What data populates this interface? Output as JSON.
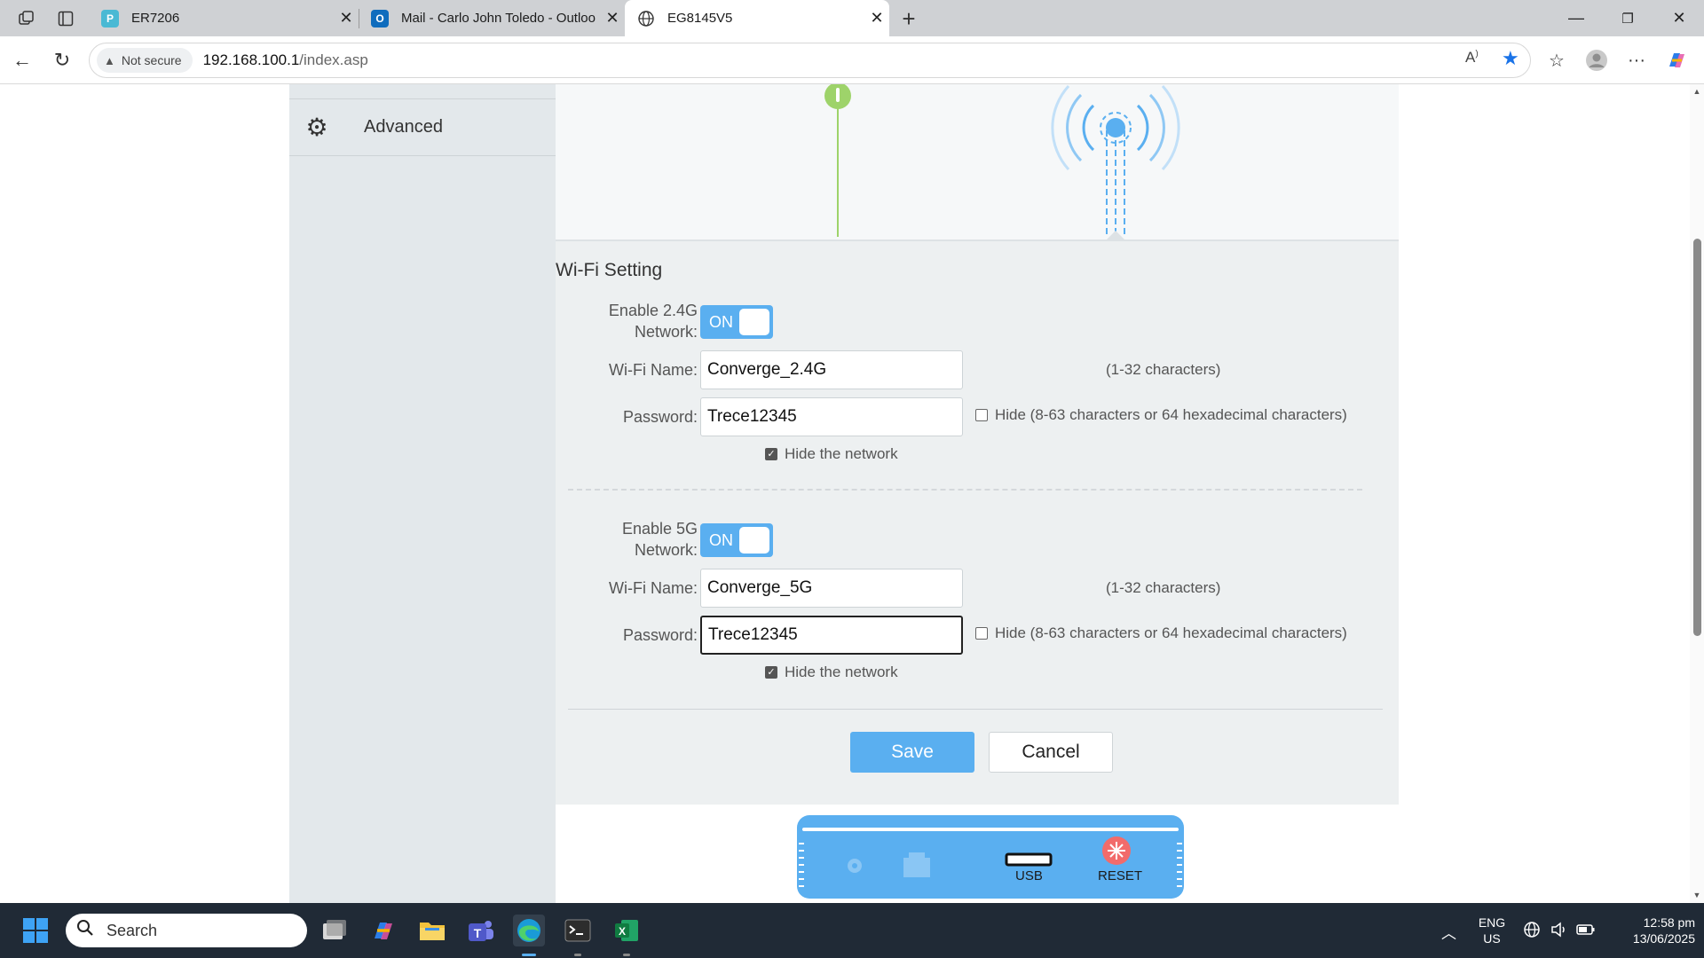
{
  "browser": {
    "tabs": [
      {
        "title": "ER7206",
        "favicon": "tp-link-icon",
        "active": false
      },
      {
        "title": "Mail - Carlo John Toledo - Outloo",
        "favicon": "outlook-icon",
        "active": false
      },
      {
        "title": "EG8145V5",
        "favicon": "globe-icon",
        "active": true
      }
    ],
    "new_tab_label": "+",
    "address": {
      "security_label": "Not secure",
      "host": "192.168.100.1",
      "path": "/index.asp"
    }
  },
  "sidebar": {
    "advanced_label": "Advanced",
    "advanced_icon": "gear-icon"
  },
  "wifi": {
    "section_title": "Wi-Fi Setting",
    "band_24": {
      "enable_label": "Enable 2.4G Network:",
      "toggle_state": "ON",
      "name_label": "Wi-Fi Name:",
      "name_value": "Converge_2.4G",
      "name_hint": "(1-32 characters)",
      "password_label": "Password:",
      "password_value": "Trece12345",
      "password_hint": "Hide (8-63 characters or 64 hexadecimal characters)",
      "hide_password_checked": false,
      "hide_network_label": "Hide the network",
      "hide_network_checked": true
    },
    "band_5": {
      "enable_label": "Enable 5G Network:",
      "toggle_state": "ON",
      "name_label": "Wi-Fi Name:",
      "name_value": "Converge_5G",
      "name_hint": "(1-32 characters)",
      "password_label": "Password:",
      "password_value": "Trece12345",
      "password_hint": "Hide (8-63 characters or 64 hexadecimal characters)",
      "hide_password_checked": false,
      "hide_network_label": "Hide the network",
      "hide_network_checked": true
    },
    "save_label": "Save",
    "cancel_label": "Cancel"
  },
  "device_panel": {
    "usb_label": "USB",
    "reset_label": "RESET"
  },
  "taskbar": {
    "search_placeholder": "Search",
    "language": "ENG",
    "region": "US",
    "time": "12:58 pm",
    "date": "13/06/2025"
  },
  "colors": {
    "accent": "#5aaff0",
    "tabbar": "#cfd1d4",
    "taskbar": "#202a36",
    "content_bg": "#edf0f1",
    "sidebar_bg": "#e3e8eb"
  }
}
